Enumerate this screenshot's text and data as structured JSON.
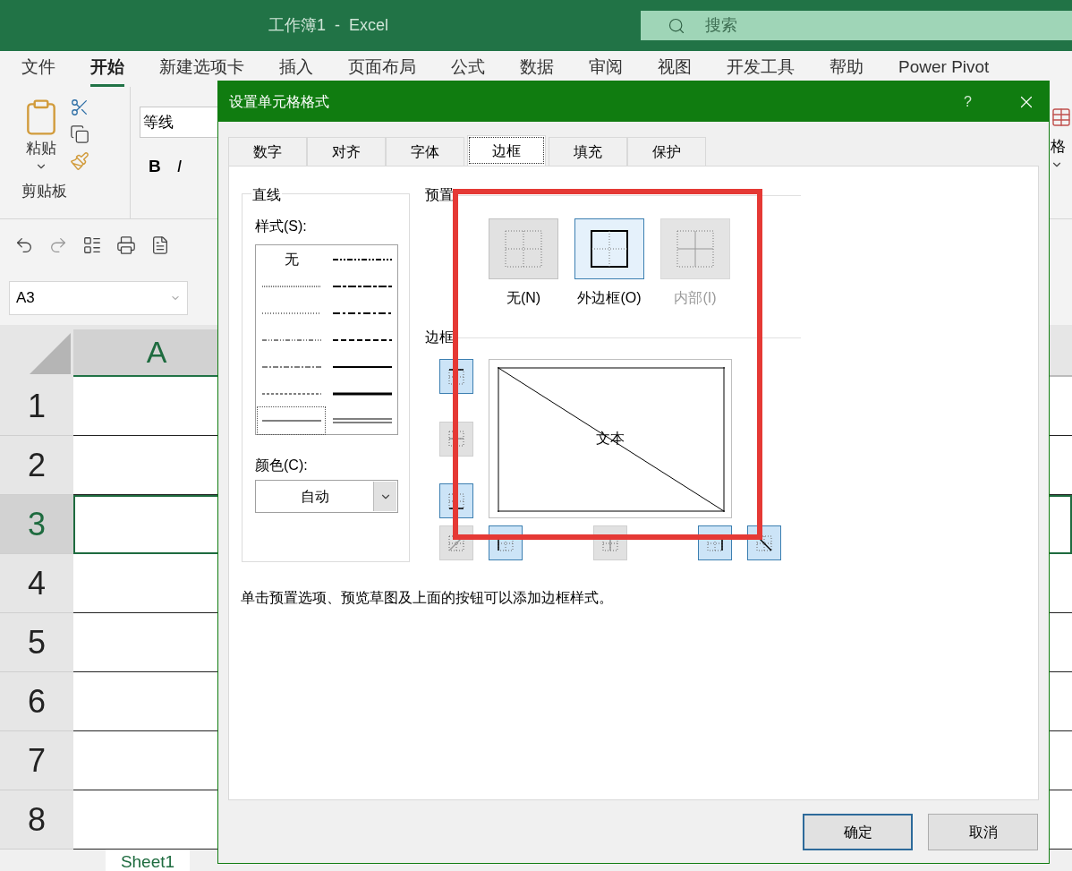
{
  "window": {
    "title": "工作簿1  -  Excel"
  },
  "search": {
    "placeholder": "搜索"
  },
  "ribbon_tabs": [
    {
      "label": "文件",
      "selected": false
    },
    {
      "label": "开始",
      "selected": true
    },
    {
      "label": "新建选项卡",
      "selected": false
    },
    {
      "label": "插入",
      "selected": false
    },
    {
      "label": "页面布局",
      "selected": false
    },
    {
      "label": "公式",
      "selected": false
    },
    {
      "label": "数据",
      "selected": false
    },
    {
      "label": "审阅",
      "selected": false
    },
    {
      "label": "视图",
      "selected": false
    },
    {
      "label": "开发工具",
      "selected": false
    },
    {
      "label": "帮助",
      "selected": false
    },
    {
      "label": "Power Pivot",
      "selected": false
    }
  ],
  "ribbon": {
    "paste_label": "粘贴",
    "clipboard_group": "剪贴板",
    "font_name": "等线",
    "bold": "B",
    "italic": "I",
    "format_label": "格"
  },
  "name_box": {
    "value": "A3"
  },
  "sheet": {
    "columns": [
      {
        "label": "A",
        "selected": true
      }
    ],
    "rows": [
      {
        "label": "1",
        "selected": false
      },
      {
        "label": "2",
        "selected": false
      },
      {
        "label": "3",
        "selected": true
      },
      {
        "label": "4",
        "selected": false
      },
      {
        "label": "5",
        "selected": false
      },
      {
        "label": "6",
        "selected": false
      },
      {
        "label": "7",
        "selected": false
      },
      {
        "label": "8",
        "selected": false
      }
    ]
  },
  "sheet_tabs": [
    {
      "label": "Sheet1",
      "selected": true
    }
  ],
  "dialog": {
    "title": "设置单元格格式",
    "help": "?",
    "tabs": [
      {
        "label": "数字",
        "selected": false
      },
      {
        "label": "对齐",
        "selected": false
      },
      {
        "label": "字体",
        "selected": false
      },
      {
        "label": "边框",
        "selected": true
      },
      {
        "label": "填充",
        "selected": false
      },
      {
        "label": "保护",
        "selected": false
      }
    ],
    "line_group": {
      "title": "直线",
      "style_label": "样式(S):",
      "styles": [
        {
          "kind": "none",
          "label": "无",
          "selected": false
        },
        {
          "kind": "hair",
          "selected": false
        },
        {
          "kind": "dotted",
          "selected": false
        },
        {
          "kind": "dash_dot_dot",
          "selected": false
        },
        {
          "kind": "dash_dot",
          "selected": false
        },
        {
          "kind": "dashed",
          "selected": false
        },
        {
          "kind": "thin",
          "selected": true
        },
        {
          "kind": "medium_dash_dot_dot",
          "selected": false
        },
        {
          "kind": "slant_dash_dot",
          "selected": false
        },
        {
          "kind": "medium_dash_dot",
          "selected": false
        },
        {
          "kind": "medium_dashed",
          "selected": false
        },
        {
          "kind": "medium",
          "selected": false
        },
        {
          "kind": "thick",
          "selected": false
        },
        {
          "kind": "double",
          "selected": false
        }
      ],
      "color_label": "颜色(C):",
      "color_value": "自动"
    },
    "preset_group": {
      "title": "预置",
      "presets": [
        {
          "kind": "none",
          "label": "无(N)",
          "selected": false,
          "disabled": false
        },
        {
          "kind": "outline",
          "label": "外边框(O)",
          "selected": true,
          "disabled": false
        },
        {
          "kind": "inside",
          "label": "内部(I)",
          "selected": false,
          "disabled": true
        }
      ]
    },
    "border_group": {
      "title": "边框",
      "preview_text": "文本",
      "toggles": [
        {
          "kind": "top",
          "on": true
        },
        {
          "kind": "inner_horizontal",
          "on": false
        },
        {
          "kind": "bottom",
          "on": true
        },
        {
          "kind": "diag_up",
          "on": false
        },
        {
          "kind": "left",
          "on": true
        },
        {
          "kind": "inner_vertical",
          "on": false
        },
        {
          "kind": "right",
          "on": true
        },
        {
          "kind": "diag_down",
          "on": true
        }
      ]
    },
    "hint": "单击预置选项、预览草图及上面的按钮可以添加边框样式。",
    "buttons": [
      {
        "kind": "primary",
        "label": "确定"
      },
      {
        "kind": "secondary",
        "label": "取消"
      }
    ]
  }
}
